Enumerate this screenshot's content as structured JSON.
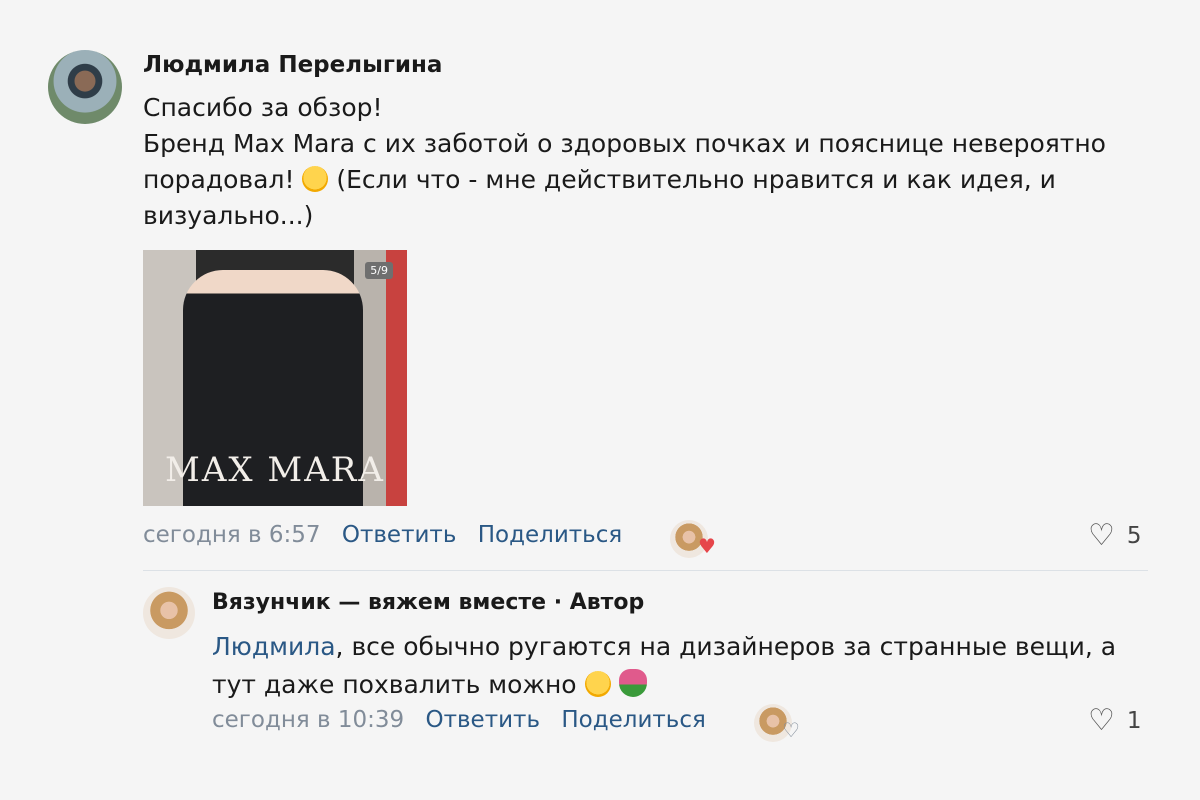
{
  "comment1": {
    "author": "Людмила Перелыгина",
    "line1": "Спасибо за обзор!",
    "line2": "Бренд Max Mara с их заботой о здоровых почках и пояснице невероятно",
    "line3a": "порадовал!",
    "line3b": "(Если что - мне действительно нравится и как идея, и",
    "line4": "визуально...)",
    "photo_badge": "5/9",
    "photo_brand": "MAX MARA",
    "time": "сегодня в 6:57",
    "reply": "Ответить",
    "share": "Поделиться",
    "likes": "5"
  },
  "comment2": {
    "author": "Вязунчик — вяжем вместе · Автор",
    "mention": "Людмила",
    "text_a": ", все обычно ругаются на дизайнеров за странные вещи, а",
    "text_b": "тут даже похвалить можно",
    "time": "сегодня в 10:39",
    "reply": "Ответить",
    "share": "Поделиться",
    "likes": "1"
  },
  "icons": {
    "like": "heart-icon",
    "hug": "hugging-face-emoji",
    "grin": "grinning-face-emoji",
    "tulip": "tulip-emoji"
  }
}
